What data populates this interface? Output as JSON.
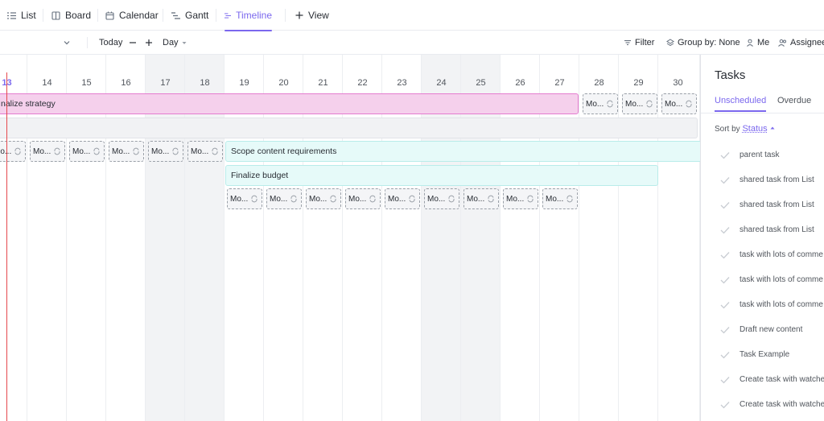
{
  "view_tabs": [
    {
      "label": "List",
      "icon": "list-icon"
    },
    {
      "label": "Board",
      "icon": "board-icon"
    },
    {
      "label": "Calendar",
      "icon": "calendar-icon"
    },
    {
      "label": "Gantt",
      "icon": "gantt-icon"
    },
    {
      "label": "Timeline",
      "icon": "timeline-icon",
      "active": true
    }
  ],
  "add_view_label": "View",
  "toolbar": {
    "today_label": "Today",
    "zoom_label": "Day",
    "filter_label": "Filter",
    "group_by_label": "Group by: None",
    "me_label": "Me",
    "assignee_label": "Assignee"
  },
  "timeline": {
    "days": [
      "13",
      "14",
      "15",
      "16",
      "17",
      "18",
      "19",
      "20",
      "21",
      "22",
      "23",
      "24",
      "25",
      "26",
      "27",
      "28",
      "29",
      "30"
    ],
    "today": "13",
    "weekend_days": [
      "17",
      "18",
      "24",
      "25"
    ],
    "tasks": {
      "strategy": "nalize strategy",
      "scope": "Scope content requirements",
      "budget": "Finalize budget"
    },
    "chip_label": "Mo..."
  },
  "panel": {
    "title": "Tasks",
    "tabs": [
      "Unscheduled",
      "Overdue"
    ],
    "sort_label": "Sort by",
    "sort_value": "Status",
    "items": [
      "parent task",
      "shared task from List",
      "shared task from List",
      "shared task from List",
      "task with lots of comme",
      "task with lots of comme",
      "task with lots of comme",
      "Draft new content",
      "Task Example",
      "Create task with watche",
      "Create task with watche"
    ]
  },
  "colors": {
    "accent": "#7b68ee",
    "today_line": "#e5484d",
    "pink_bar": "#f5d0ec",
    "teal_bar": "#e6faf9"
  }
}
